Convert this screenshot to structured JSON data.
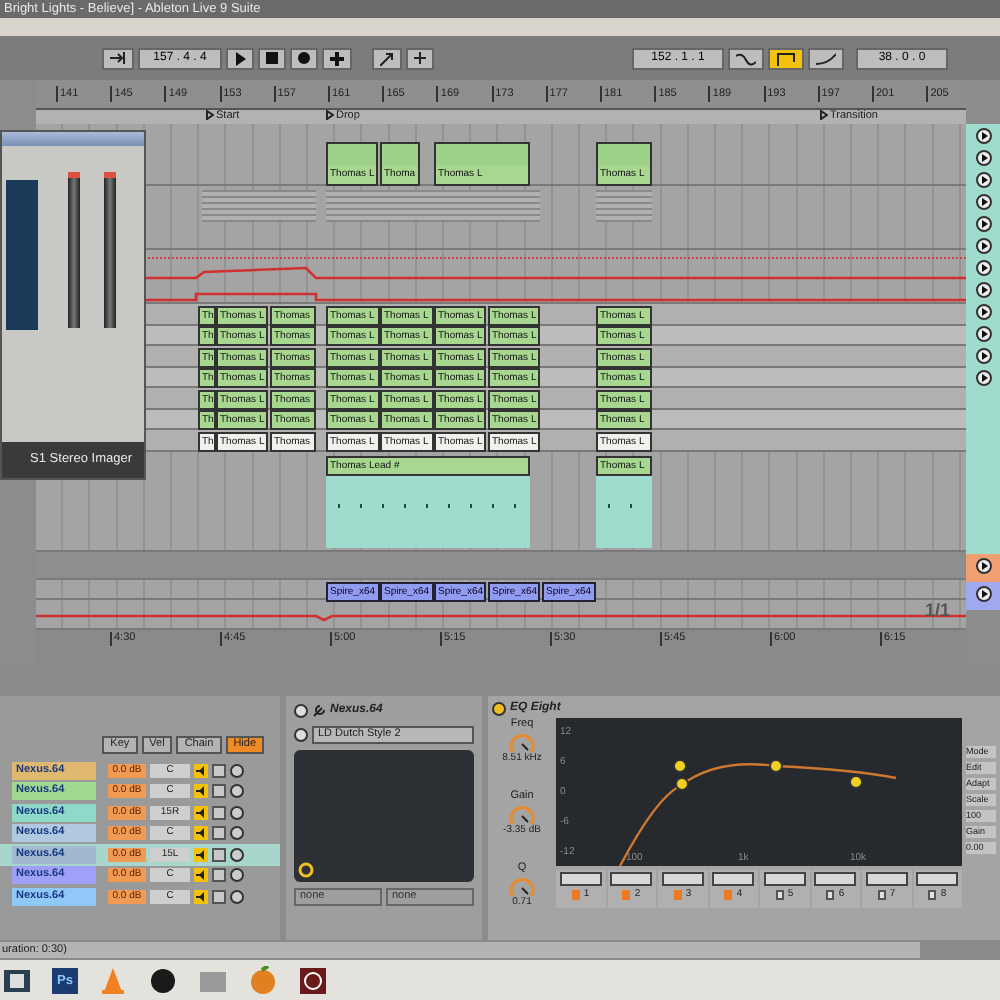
{
  "window": {
    "title": "Bright Lights - Believe] - Ableton Live 9 Suite"
  },
  "transport": {
    "position": "157 . 4 . 4",
    "loop_start": "152 . 1 . 1",
    "loop_length": "38 . 0 . 0",
    "switches": [
      {
        "on": false
      },
      {
        "on": true
      },
      {
        "on": false
      }
    ]
  },
  "ruler": [
    "141",
    "145",
    "149",
    "153",
    "157",
    "161",
    "165",
    "169",
    "173",
    "177",
    "181",
    "185",
    "189",
    "193",
    "197",
    "201",
    "205"
  ],
  "locators": [
    {
      "label": "Start"
    },
    {
      "label": "Drop"
    },
    {
      "label": "Transition"
    }
  ],
  "top_clips": [
    "Thomas L",
    "Thoma",
    "Thomas L",
    "Thomas L"
  ],
  "clip_rows": [
    {
      "color": "#a8d890",
      "clips": [
        "Th",
        "Thomas L",
        "Thomas",
        "Thomas L",
        "Thomas L",
        "Thomas L",
        "Thomas L",
        "Thomas L"
      ]
    },
    {
      "color": "#a8d890",
      "clips": [
        "Th",
        "Thomas L",
        "Thomas",
        "Thomas L",
        "Thomas L",
        "Thomas L",
        "Thomas L",
        "Thomas L"
      ]
    },
    {
      "color": "#a8d890",
      "clips": [
        "Th",
        "Thomas L",
        "Thomas",
        "Thomas L",
        "Thomas L",
        "Thomas L",
        "Thomas L",
        "Thomas L"
      ]
    },
    {
      "color": "#a8d890",
      "clips": [
        "Th",
        "Thomas L",
        "Thomas",
        "Thomas L",
        "Thomas L",
        "Thomas L",
        "Thomas L",
        "Thomas L"
      ]
    },
    {
      "color": "#a8d890",
      "clips": [
        "Th",
        "Thomas L",
        "Thomas",
        "Thomas L",
        "Thomas L",
        "Thomas L",
        "Thomas L",
        "Thomas L"
      ]
    },
    {
      "color": "#a8d890",
      "clips": [
        "Th",
        "Thomas L",
        "Thomas",
        "Thomas L",
        "Thomas L",
        "Thomas L",
        "Thomas L",
        "Thomas L"
      ]
    },
    {
      "color": "#f0f0ec",
      "clips": [
        "Th",
        "Thomas L",
        "Thomas",
        "Thomas L",
        "Thomas L",
        "Thomas L",
        "Thomas L",
        "Thomas L"
      ]
    }
  ],
  "lead_clips": [
    "Thomas Lead #",
    "Thomas L"
  ],
  "spire_clips": [
    "Spire_x64",
    "Spire_x64",
    "Spire_x64",
    "Spire_x64",
    "Spire_x64"
  ],
  "time_ruler": [
    "4:30",
    "4:45",
    "5:00",
    "5:15",
    "5:30",
    "5:45",
    "6:00",
    "6:15"
  ],
  "page": "1/1",
  "plugin": {
    "title": "S1 Stereo Imager"
  },
  "chain": {
    "buttons": [
      {
        "label": "Key",
        "selected": false
      },
      {
        "label": "Vel",
        "selected": false
      },
      {
        "label": "Chain",
        "selected": false
      },
      {
        "label": "Hide",
        "selected": true
      }
    ],
    "rows": [
      {
        "name": "Nexus.64",
        "volume": "0.0 dB",
        "pan": "C",
        "color": "#e0b870",
        "selected": false
      },
      {
        "name": "Nexus.64",
        "volume": "0.0 dB",
        "pan": "C",
        "color": "#a0d890",
        "selected": false
      },
      {
        "name": "Nexus.64",
        "volume": "0.0 dB",
        "pan": "15R",
        "color": "#90d8c8",
        "selected": false
      },
      {
        "name": "Nexus.64",
        "volume": "0.0 dB",
        "pan": "C",
        "color": "#b0c8e0",
        "selected": false
      },
      {
        "name": "Nexus.64",
        "volume": "0.0 dB",
        "pan": "15L",
        "color": "#a0b8d0",
        "selected": true
      },
      {
        "name": "Nexus.64",
        "volume": "0.0 dB",
        "pan": "C",
        "color": "#a0a0f8",
        "selected": false
      },
      {
        "name": "Nexus.64",
        "volume": "0.0 dB",
        "pan": "C",
        "color": "#90c8f8",
        "selected": false
      }
    ]
  },
  "instrument": {
    "title": "Nexus.64",
    "preset": "LD Dutch Style 2",
    "x_label": "none",
    "y_label": "none"
  },
  "eq": {
    "title": "EQ Eight",
    "knobs": [
      {
        "label": "Freq",
        "value": "8.51 kHz"
      },
      {
        "label": "Gain",
        "value": "-3.35 dB"
      },
      {
        "label": "Q",
        "value": "0.71"
      }
    ],
    "y_labels": [
      "12",
      "6",
      "0",
      "-6",
      "-12"
    ],
    "x_labels": [
      "100",
      "1k",
      "10k"
    ],
    "bands": [
      {
        "number": "1",
        "on": true
      },
      {
        "number": "2",
        "on": true
      },
      {
        "number": "3",
        "on": true
      },
      {
        "number": "4",
        "on": true
      },
      {
        "number": "5",
        "on": false
      },
      {
        "number": "6",
        "on": false
      },
      {
        "number": "7",
        "on": false
      },
      {
        "number": "8",
        "on": false
      }
    ]
  },
  "side_panel": [
    "Mode",
    "Edit",
    "Adapt",
    "Scale",
    "100",
    "Gain",
    "0.00"
  ],
  "status": "uration: 0:30)",
  "taskbar": {
    "ps_label": "Ps"
  }
}
